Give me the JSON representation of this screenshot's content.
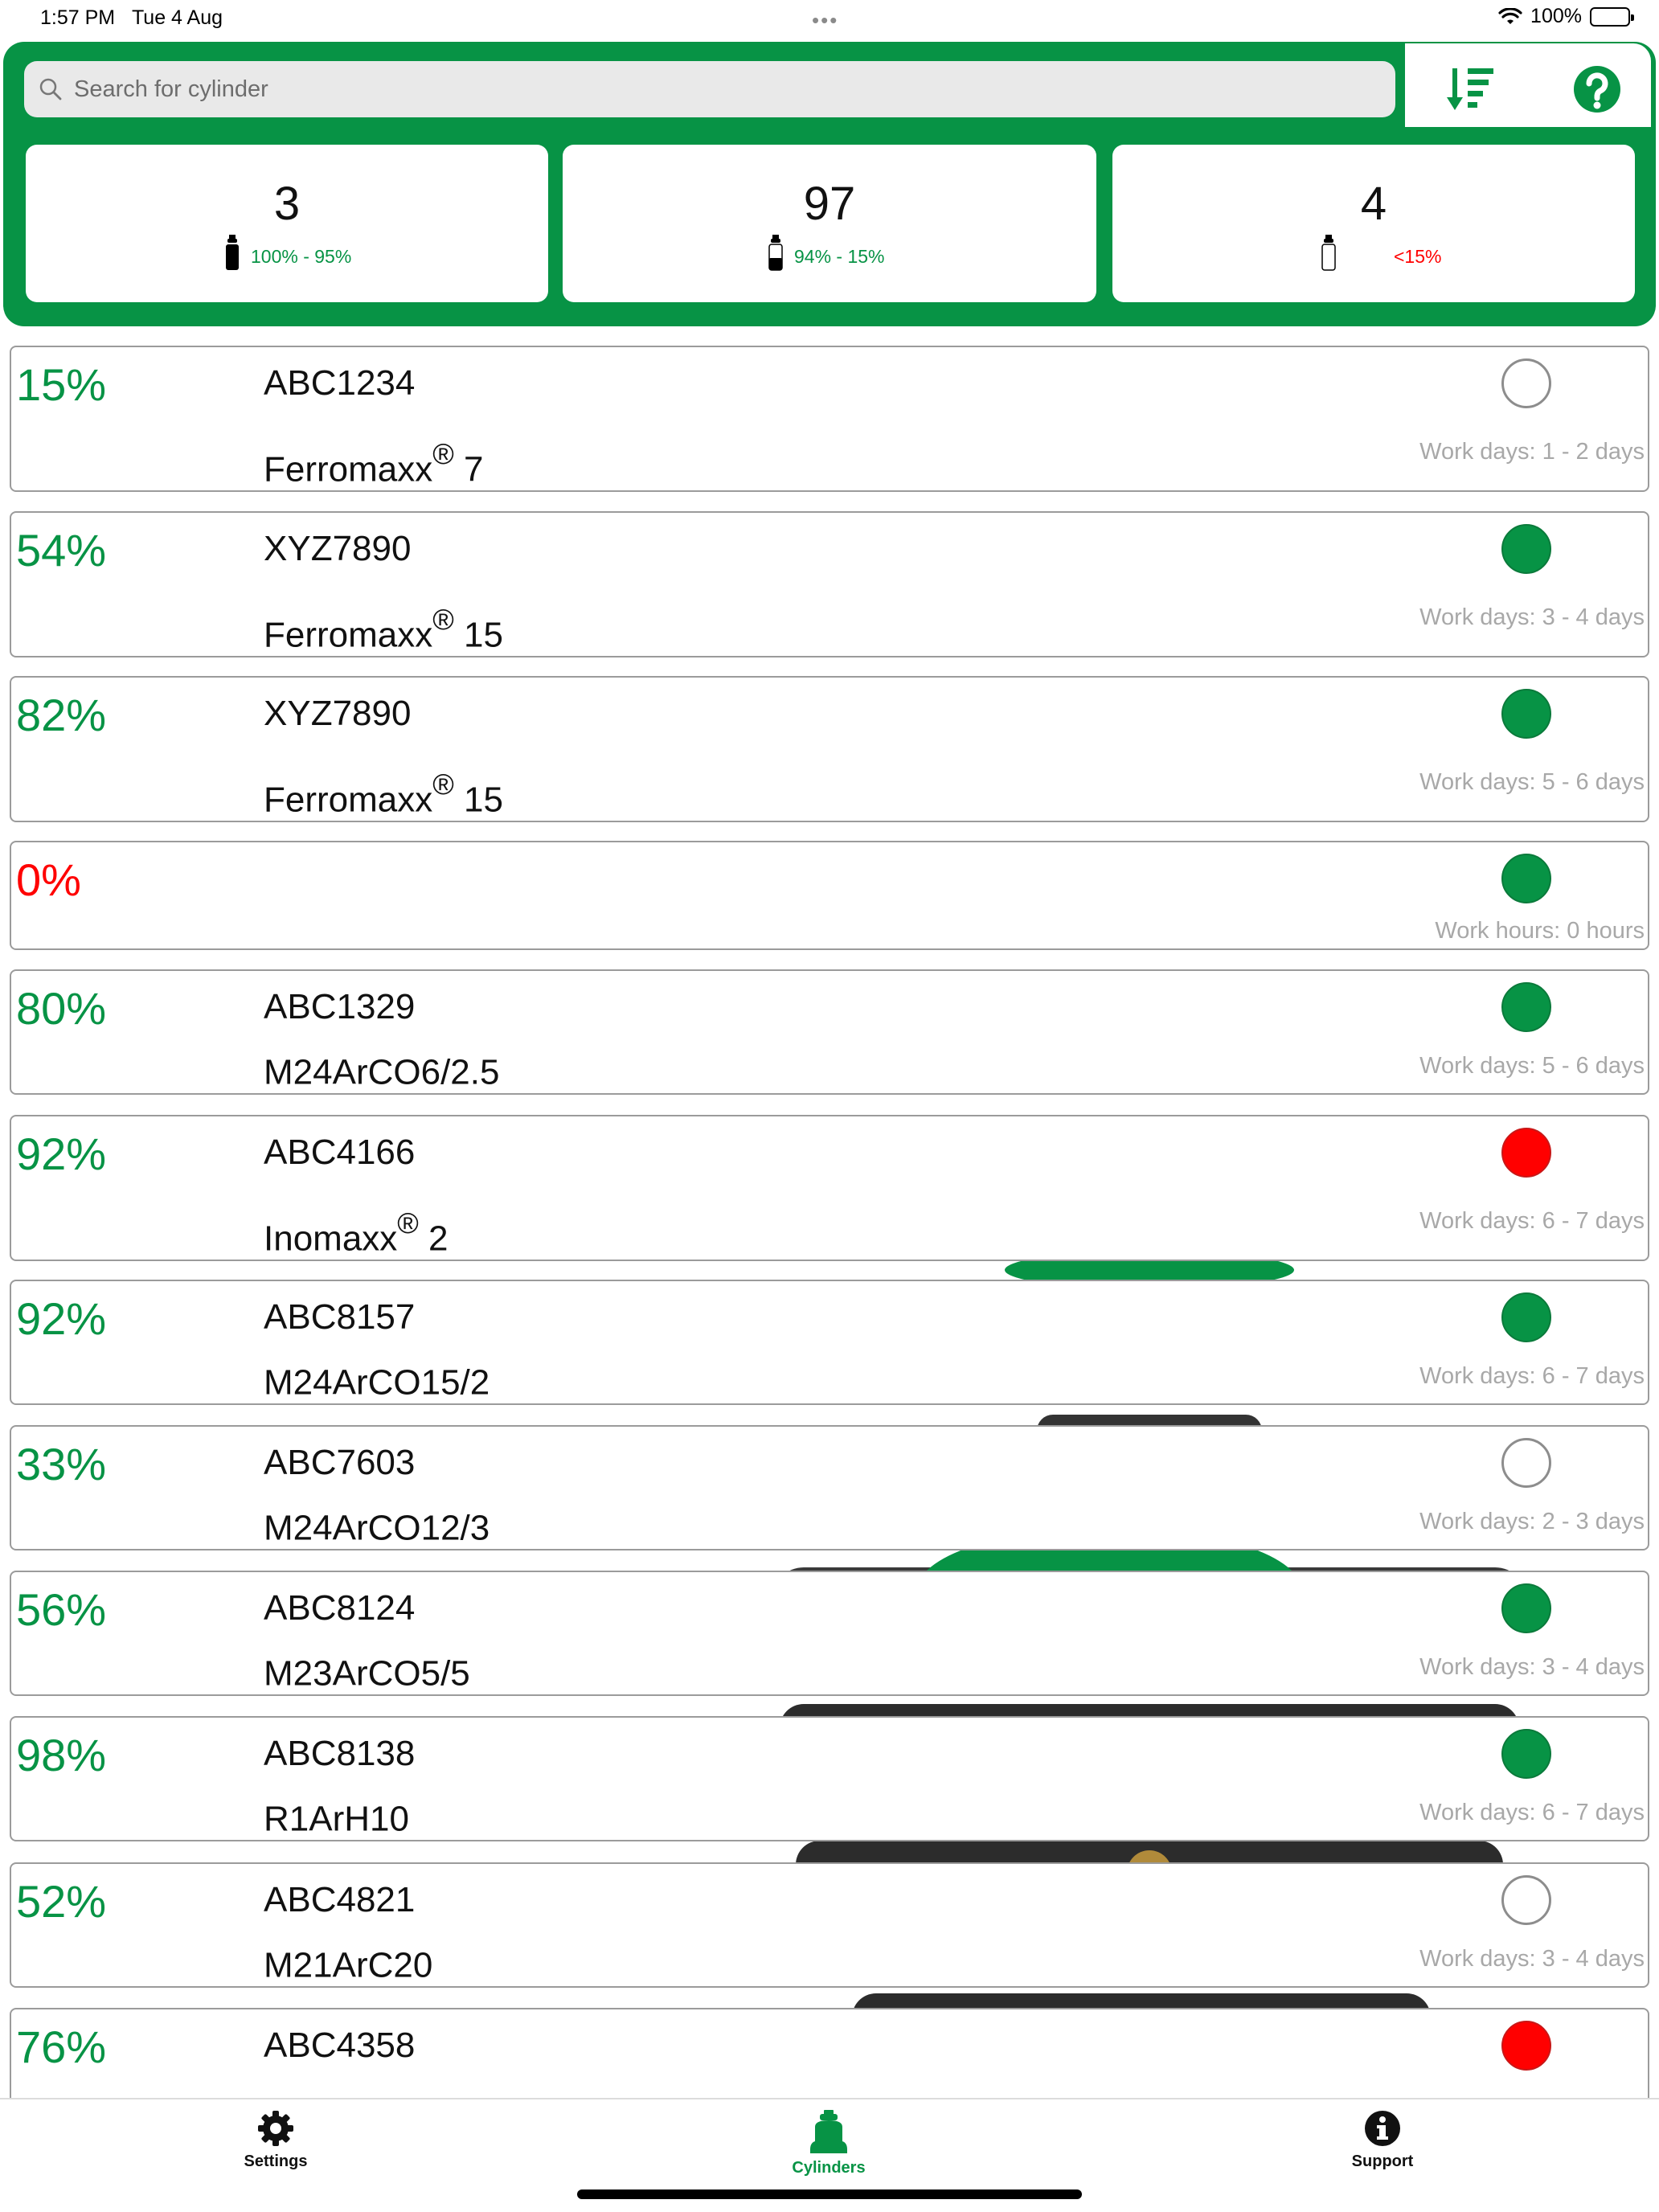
{
  "status_bar": {
    "time": "1:57 PM",
    "date": "Tue 4 Aug",
    "battery": "100%"
  },
  "search": {
    "placeholder": "Search for cylinder"
  },
  "icons": {
    "search": "search-icon",
    "sort": "sort-descending-icon",
    "help": "help-circle-icon",
    "settings": "gear-icon",
    "cylinders": "cylinder-icon",
    "support": "info-icon"
  },
  "summary": [
    {
      "count": "3",
      "range": "100% - 95%",
      "color": "#079345",
      "level": 1.0
    },
    {
      "count": "97",
      "range": "94% - 15%",
      "color": "#079345",
      "level": 0.5
    },
    {
      "count": "4",
      "range": "<15%",
      "color": "#ff0000",
      "level": 0.0
    }
  ],
  "colors": {
    "accent": "#079345",
    "alert": "#ff0000",
    "muted": "#a8a8a8"
  },
  "cylinders": [
    {
      "pct": "15%",
      "pct_color": "green",
      "serial": "ABC1234",
      "product": "Ferromaxx",
      "reg": "®",
      "suffix": " 7",
      "status": "empty",
      "workdays": "Work days: 1 - 2 days"
    },
    {
      "pct": "54%",
      "pct_color": "green",
      "serial": "XYZ7890",
      "product": "Ferromaxx",
      "reg": "®",
      "suffix": " 15",
      "status": "green",
      "workdays": "Work days: 3 - 4 days"
    },
    {
      "pct": "82%",
      "pct_color": "green",
      "serial": "XYZ7890",
      "product": "Ferromaxx",
      "reg": "®",
      "suffix": " 15",
      "status": "green",
      "workdays": "Work days: 5 - 6 days"
    },
    {
      "pct": "0%",
      "pct_color": "red",
      "serial": "",
      "product": "",
      "reg": "",
      "suffix": "",
      "status": "green",
      "workdays": "Work hours: 0 hours"
    },
    {
      "pct": "80%",
      "pct_color": "green",
      "serial": "ABC1329",
      "product": "M24ArCO6/2.5",
      "reg": "",
      "suffix": "",
      "status": "green",
      "workdays": "Work days: 5 - 6 days"
    },
    {
      "pct": "92%",
      "pct_color": "green",
      "serial": "ABC4166",
      "product": "Inomaxx",
      "reg": "®",
      "suffix": " 2",
      "status": "red",
      "workdays": "Work days: 6 - 7 days"
    },
    {
      "pct": "92%",
      "pct_color": "green",
      "serial": "ABC8157",
      "product": "M24ArCO15/2",
      "reg": "",
      "suffix": "",
      "status": "green",
      "workdays": "Work days: 6 - 7 days"
    },
    {
      "pct": "33%",
      "pct_color": "green",
      "serial": "ABC7603",
      "product": "M24ArCO12/3",
      "reg": "",
      "suffix": "",
      "status": "empty",
      "workdays": "Work days: 2 - 3 days"
    },
    {
      "pct": "56%",
      "pct_color": "green",
      "serial": "ABC8124",
      "product": "M23ArCO5/5",
      "reg": "",
      "suffix": "",
      "status": "green",
      "workdays": "Work days: 3 - 4 days"
    },
    {
      "pct": "98%",
      "pct_color": "green",
      "serial": "ABC8138",
      "product": "R1ArH10",
      "reg": "",
      "suffix": "",
      "status": "green",
      "workdays": "Work days: 6 - 7 days"
    },
    {
      "pct": "52%",
      "pct_color": "green",
      "serial": "ABC4821",
      "product": "M21ArC20",
      "reg": "",
      "suffix": "",
      "status": "empty",
      "workdays": "Work days: 3 - 4 days"
    },
    {
      "pct": "76%",
      "pct_color": "green",
      "serial": "ABC4358",
      "product": "",
      "reg": "",
      "suffix": "",
      "status": "red",
      "workdays": ""
    }
  ],
  "tabs": [
    {
      "label": "Settings",
      "color": "#111111",
      "icon": "gear-icon"
    },
    {
      "label": "Cylinders",
      "color": "#079345",
      "icon": "cylinder-icon"
    },
    {
      "label": "Support",
      "color": "#111111",
      "icon": "info-icon"
    }
  ]
}
